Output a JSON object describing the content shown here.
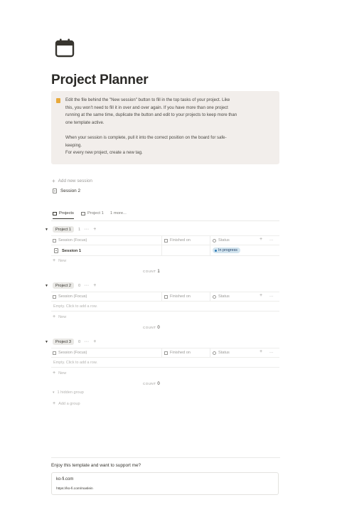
{
  "page": {
    "icon": "calendar-icon",
    "title": "Project Planner"
  },
  "callout": {
    "icon": "lightbulb-icon",
    "lines": [
      "Edit the file behind the \"New session\" button to fill in the top tasks of your project. Like",
      "this, you won't need to fill it in over and over again. If you have more than one project",
      "running at the same time, duplicate the button and edit to your projects to keep more than",
      "one template active.",
      "When your session is complete, pull it into the correct position on the board for safe-",
      "keeping.",
      "For every new project, create a new tag."
    ]
  },
  "buttons": {
    "add_new_session": "Add new session"
  },
  "linked_page": "Session 2",
  "tabs": [
    {
      "label": "Projects",
      "icon": "table-icon",
      "active": true
    },
    {
      "label": "Project 1",
      "icon": "board-icon",
      "active": false
    },
    {
      "label": "1 more...",
      "icon": "",
      "active": false
    }
  ],
  "columns": {
    "name": "Session (Focus)",
    "finished": "Finished on",
    "status": "Status",
    "add": "+",
    "more": "···"
  },
  "groups": [
    {
      "name": "Project 1",
      "count": "1",
      "rows": [
        {
          "name": "Session 1",
          "status": "In progress"
        }
      ],
      "empty_text": "",
      "count_label": "COUNT",
      "count_value": "1"
    },
    {
      "name": "Project 2",
      "count": "0",
      "rows": [],
      "empty_text": "Empty. Click to add a row.",
      "count_label": "COUNT",
      "count_value": "0"
    },
    {
      "name": "Project 3",
      "count": "0",
      "rows": [],
      "empty_text": "Empty. Click to add a row.",
      "count_label": "COUNT",
      "count_value": "0"
    }
  ],
  "new_label": "New",
  "hidden_groups": "1 hidden group",
  "add_group": "Add a group",
  "footer": {
    "support_text": "Enjoy this template and want to support me?",
    "bookmark_title": "ko-fi.com",
    "bookmark_url": "https://ko-fi.com/maslein"
  },
  "colors": {
    "callout_bg": "#f2eeeb",
    "status_in_progress": "#d3e5ef",
    "accent_text": "#37352f"
  }
}
